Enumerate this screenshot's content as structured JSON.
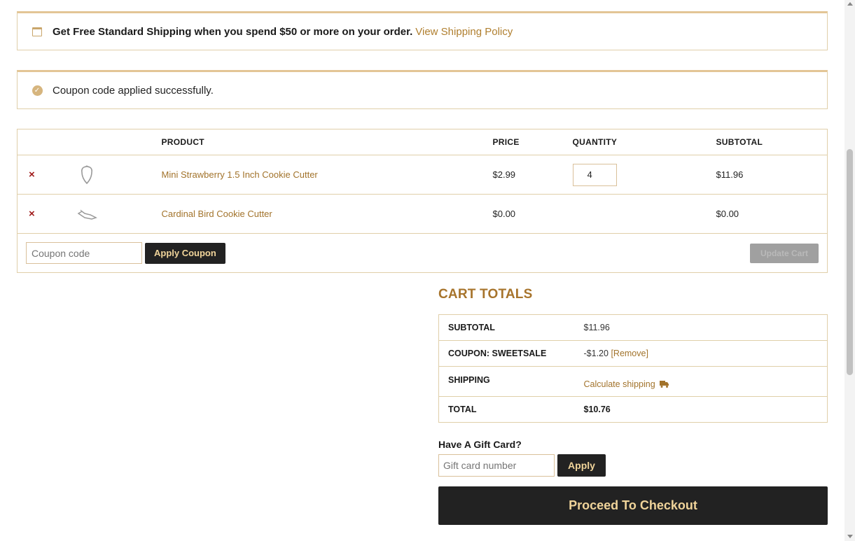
{
  "notices": {
    "shipping": {
      "icon": "calendar-icon",
      "text": "Get Free Standard Shipping when you spend $50 or more on your order.",
      "link": "View Shipping Policy"
    },
    "coupon": {
      "icon": "check-circle-icon",
      "text": "Coupon code applied successfully."
    }
  },
  "cart": {
    "headers": {
      "product": "PRODUCT",
      "price": "PRICE",
      "quantity": "QUANTITY",
      "subtotal": "SUBTOTAL"
    },
    "items": [
      {
        "remove": "×",
        "thumb_icon": "strawberry-cutter-icon",
        "name": "Mini Strawberry 1.5 Inch Cookie Cutter",
        "price": "$2.99",
        "quantity": "4",
        "subtotal": "$11.96"
      },
      {
        "remove": "×",
        "thumb_icon": "bird-cutter-icon",
        "name": "Cardinal Bird Cookie Cutter",
        "price": "$0.00",
        "quantity": "",
        "subtotal": "$0.00"
      }
    ],
    "coupon_placeholder": "Coupon code",
    "apply_coupon_label": "Apply Coupon",
    "update_cart_label": "Update Cart"
  },
  "totals": {
    "title": "CART TOTALS",
    "subtotal_label": "SUBTOTAL",
    "subtotal_value": "$11.96",
    "coupon_label": "COUPON: SWEETSALE",
    "coupon_value": "-$1.20",
    "coupon_remove": "[Remove]",
    "shipping_label": "SHIPPING",
    "shipping_link": "Calculate shipping",
    "shipping_icon": "truck-icon",
    "total_label": "TOTAL",
    "total_value": "$10.76"
  },
  "gift_card": {
    "title": "Have A Gift Card?",
    "placeholder": "Gift card number",
    "apply_label": "Apply"
  },
  "checkout_label": "Proceed To Checkout",
  "colors": {
    "accent": "#a7742c",
    "link": "#b07f2f",
    "border": "#e0cfa9",
    "dark_button": "#222222",
    "button_text": "#f0d49a",
    "remove": "#a01b1b"
  }
}
